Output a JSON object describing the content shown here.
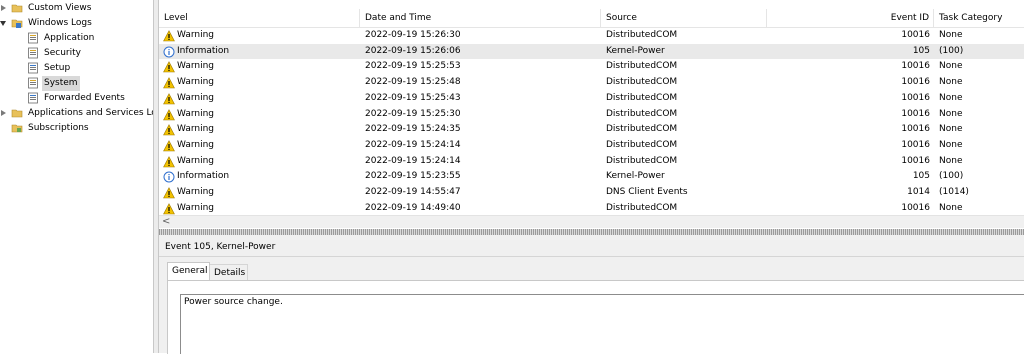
{
  "tree": {
    "items": [
      {
        "label": "Custom Views"
      },
      {
        "label": "Windows Logs"
      },
      {
        "label": "Application"
      },
      {
        "label": "Security"
      },
      {
        "label": "Setup"
      },
      {
        "label": "System"
      },
      {
        "label": "Forwarded Events"
      },
      {
        "label": "Applications and Services Lo"
      },
      {
        "label": "Subscriptions"
      }
    ]
  },
  "columns": {
    "level": "Level",
    "datetime": "Date and Time",
    "source": "Source",
    "event_id": "Event ID",
    "task_category": "Task Category"
  },
  "rows": [
    {
      "level": "Warning",
      "datetime": "2022-09-19 15:26:30",
      "source": "DistributedCOM",
      "event_id": "10016",
      "task": "None"
    },
    {
      "level": "Information",
      "datetime": "2022-09-19 15:26:06",
      "source": "Kernel-Power",
      "event_id": "105",
      "task": "(100)"
    },
    {
      "level": "Warning",
      "datetime": "2022-09-19 15:25:53",
      "source": "DistributedCOM",
      "event_id": "10016",
      "task": "None"
    },
    {
      "level": "Warning",
      "datetime": "2022-09-19 15:25:48",
      "source": "DistributedCOM",
      "event_id": "10016",
      "task": "None"
    },
    {
      "level": "Warning",
      "datetime": "2022-09-19 15:25:43",
      "source": "DistributedCOM",
      "event_id": "10016",
      "task": "None"
    },
    {
      "level": "Warning",
      "datetime": "2022-09-19 15:25:30",
      "source": "DistributedCOM",
      "event_id": "10016",
      "task": "None"
    },
    {
      "level": "Warning",
      "datetime": "2022-09-19 15:24:35",
      "source": "DistributedCOM",
      "event_id": "10016",
      "task": "None"
    },
    {
      "level": "Warning",
      "datetime": "2022-09-19 15:24:14",
      "source": "DistributedCOM",
      "event_id": "10016",
      "task": "None"
    },
    {
      "level": "Warning",
      "datetime": "2022-09-19 15:24:14",
      "source": "DistributedCOM",
      "event_id": "10016",
      "task": "None"
    },
    {
      "level": "Information",
      "datetime": "2022-09-19 15:23:55",
      "source": "Kernel-Power",
      "event_id": "105",
      "task": "(100)"
    },
    {
      "level": "Warning",
      "datetime": "2022-09-19 14:55:47",
      "source": "DNS Client Events",
      "event_id": "1014",
      "task": "(1014)"
    },
    {
      "level": "Warning",
      "datetime": "2022-09-19 14:49:40",
      "source": "DistributedCOM",
      "event_id": "10016",
      "task": "None"
    }
  ],
  "hscroll": {
    "left_arrow": "<"
  },
  "detail": {
    "title": "Event 105, Kernel-Power",
    "tabs": [
      "General",
      "Details"
    ],
    "description": "Power source change."
  },
  "colors": {
    "selection": "#d9d9d9",
    "warning": "#f2c200",
    "information": "#2f6fcf"
  }
}
